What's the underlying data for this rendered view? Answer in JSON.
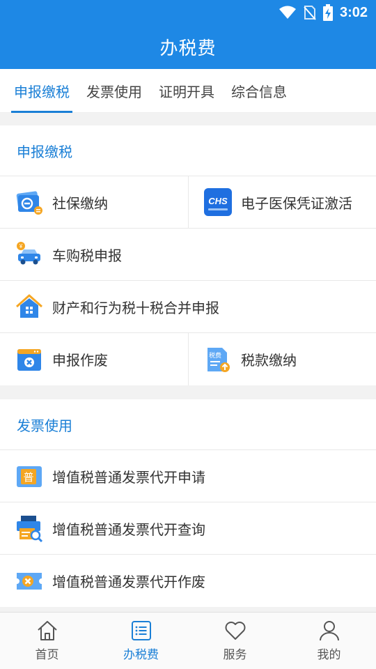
{
  "status_bar": {
    "time": "3:02",
    "icons": [
      "wifi-icon",
      "no-sim-icon",
      "battery-charging-icon"
    ]
  },
  "app_bar": {
    "title": "办税费"
  },
  "tabs": [
    {
      "label": "申报缴税",
      "active": true
    },
    {
      "label": "发票使用",
      "active": false
    },
    {
      "label": "证明开具",
      "active": false
    },
    {
      "label": "综合信息",
      "active": false
    }
  ],
  "section_declare": {
    "title": "申报缴税",
    "items": [
      {
        "label": "社保缴纳",
        "icon": "social-security-card-icon"
      },
      {
        "label": "电子医保凭证激活",
        "icon": "chs-medical-insurance-icon",
        "icon_text": "CHS"
      },
      {
        "label": "车购税申报",
        "icon": "car-icon"
      },
      {
        "label": "财产和行为税十税合并申报",
        "icon": "house-icon"
      },
      {
        "label": "申报作废",
        "icon": "cancel-declaration-icon"
      },
      {
        "label": "税款缴纳",
        "icon": "tax-payment-icon",
        "icon_text": "税费"
      }
    ]
  },
  "section_invoice": {
    "title": "发票使用",
    "items": [
      {
        "label": "增值税普通发票代开申请",
        "icon": "invoice-apply-icon",
        "icon_text": "普"
      },
      {
        "label": "增值税普通发票代开查询",
        "icon": "invoice-search-icon"
      },
      {
        "label": "增值税普通发票代开作废",
        "icon": "invoice-cancel-icon"
      }
    ]
  },
  "bottom_nav": [
    {
      "label": "首页",
      "icon": "home-icon",
      "active": false
    },
    {
      "label": "办税费",
      "icon": "list-icon",
      "active": true
    },
    {
      "label": "服务",
      "icon": "heart-icon",
      "active": false
    },
    {
      "label": "我的",
      "icon": "person-icon",
      "active": false
    }
  ],
  "colors": {
    "primary": "#1e88e5",
    "accent_text": "#1a7fd6",
    "background": "#f2f2f2"
  }
}
